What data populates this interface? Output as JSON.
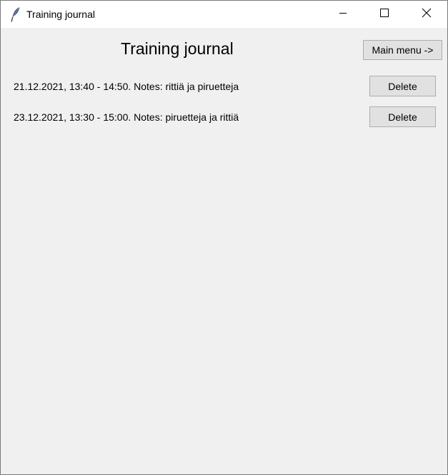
{
  "window": {
    "title": "Training journal"
  },
  "icons": {
    "app": "feather-icon",
    "minimize": "minimize-icon",
    "maximize": "maximize-icon",
    "close": "close-icon"
  },
  "header": {
    "title": "Training journal",
    "main_menu_label": "Main menu ->"
  },
  "entries": [
    {
      "text": "21.12.2021, 13:40 - 14:50. Notes: rittiä ja piruetteja",
      "delete_label": "Delete"
    },
    {
      "text": "23.12.2021, 13:30 - 15:00. Notes: piruetteja ja rittiä",
      "delete_label": "Delete"
    }
  ]
}
